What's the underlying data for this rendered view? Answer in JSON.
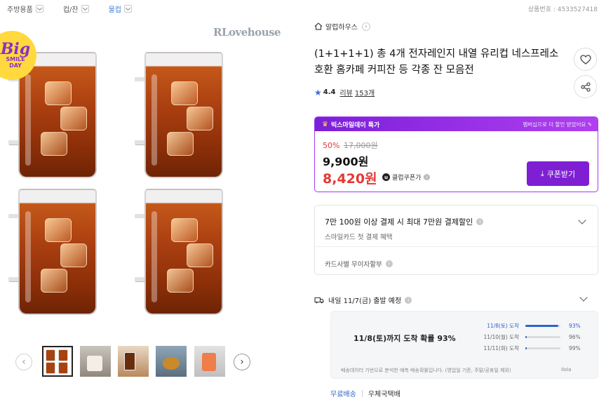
{
  "breadcrumb": [
    {
      "label": "주방용품",
      "active": false
    },
    {
      "label": "컵/잔",
      "active": false
    },
    {
      "label": "물컵",
      "active": true
    }
  ],
  "product_no": "상품번호 : 4533527418",
  "gallery": {
    "watermark": "RLovehouse",
    "badge_big": "Big",
    "badge_line1": "SMILE",
    "badge_line2": "DAY",
    "thumbnails": [
      "thumb-1",
      "thumb-2",
      "thumb-3",
      "thumb-4",
      "thumb-5"
    ],
    "selected_thumb": 1
  },
  "store": {
    "name": "알럽하우스"
  },
  "product": {
    "title": "(1+1+1+1) 총 4개 전자레인지 내열 유리컵 네스프레소 호환 홈카페 커피잔 등 각종 잔 모음전",
    "rating": "4.4",
    "reviews_label": "리뷰",
    "reviews_count": "153개"
  },
  "promo": {
    "header": "빅스마일데이 특가",
    "header_right": "멤버십으로 더 할인 받았어요",
    "discount": "50%",
    "original_price": "17,000원",
    "sale_price": "9,900원",
    "coupon_price": "8,420원",
    "coupon_tag": "클럽쿠폰가",
    "coupon_button": "쿠폰받기",
    "accent_color": "#7e1fd4",
    "price_color": "#e53935"
  },
  "card": {
    "title": "7만 100원 이상 결제 시 최대 7만원 결제할인",
    "subtitle": "스마일카드 첫 결제 혜택",
    "installment": "카드사별 무이자할부"
  },
  "shipping": {
    "departure": "내일 11/7(금) 출발 예정",
    "probability": "11/8(토)까지 도착 확률 93%",
    "distribution": [
      {
        "label": "11/8(토) 도착",
        "pct": "93%",
        "value": 0.93
      },
      {
        "label": "11/10(월) 도착",
        "pct": "96%",
        "value": 0.03
      },
      {
        "label": "11/11(화) 도착",
        "pct": "99%",
        "value": 0.03
      }
    ],
    "note": "배송데이터 기반으로 분석한 예측 배송확률입니다. (영업일 기준, 주말/공휴일 제외)",
    "note_brand": "Ilola",
    "free_shipping": "무료배송",
    "carrier": "우체국택배"
  }
}
